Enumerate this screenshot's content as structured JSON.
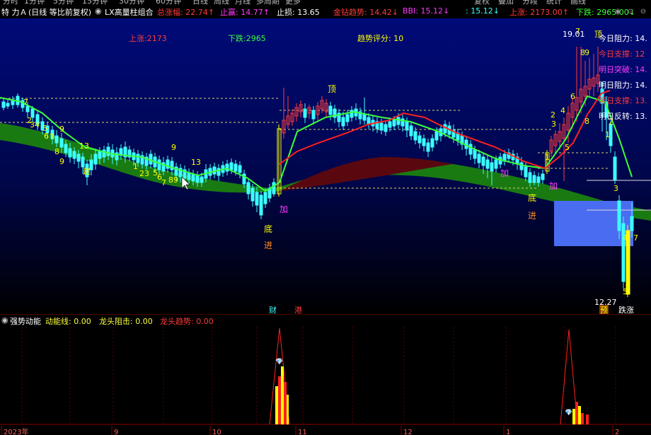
{
  "menu": [
    "分时",
    "1分钟",
    "5分钟",
    "15分钟",
    "30分钟",
    "60分钟",
    "日线",
    "周线",
    "月线",
    "多周期",
    "更多"
  ],
  "toolbar_right": [
    "复权",
    "叠加",
    "分段",
    "统计",
    "画线"
  ],
  "header": {
    "stock_name": "特 力Ａ",
    "period": "(日线 等比前复权)",
    "indicator_name": "LX高量柱组合",
    "items": [
      {
        "label": "总涨幅:",
        "value": "22.74",
        "arrow": "↑",
        "color": "#ff3b3b"
      },
      {
        "label": "止赢:",
        "value": "14.77",
        "arrow": "↑",
        "color": "#ff3bff"
      },
      {
        "label": "止损:",
        "value": "13.65",
        "arrow": "",
        "color": "#ffffff"
      },
      {
        "label": "金钻趋势:",
        "value": "14.42",
        "arrow": "↓",
        "color": "#ff3b3b"
      },
      {
        "label": "BBI:",
        "value": "15.12",
        "arrow": "↓",
        "color": "#ff3bff"
      },
      {
        "label": ":",
        "value": "15.12",
        "arrow": "↓",
        "color": "#3bffff"
      },
      {
        "label": "上涨:",
        "value": "2173.00",
        "arrow": "↑",
        "color": "#ff3b3b"
      },
      {
        "label": "下跌:",
        "value": "2965.00",
        "arrow": "↓",
        "color": "#3bff3b"
      }
    ]
  },
  "overlay": {
    "up_count": "上涨:2173",
    "down_count": "下跌:2965",
    "trend_score": "趋势评分:  10",
    "high_price": "19.01",
    "low_price": "12.27"
  },
  "levels": [
    {
      "label": "今日阻力:",
      "value": "14.",
      "color": "#ffffff"
    },
    {
      "label": "今日支撑:",
      "value": "12",
      "color": "#ff3b3b"
    },
    {
      "label": "明日突破:",
      "value": "14.",
      "color": "#ff3bff"
    },
    {
      "label": "明日阻力:",
      "value": "14.",
      "color": "#ffffff"
    },
    {
      "label": "明日支撑:",
      "value": "13.",
      "color": "#ff3b3b"
    },
    {
      "label": "明日反转:",
      "value": "13.",
      "color": "#ffffff"
    }
  ],
  "markers": {
    "ding": "顶",
    "di": "底",
    "jin": "进",
    "jia": "加",
    "cai": "财",
    "gang": "港",
    "yu": "预",
    "tie": "跌涨"
  },
  "sub": {
    "name": "强势动能",
    "items": [
      {
        "label": "动能线:",
        "value": "0.00",
        "color": "#ffff3b"
      },
      {
        "label": "龙头阻击:",
        "value": "0.00",
        "color": "#ffff3b"
      },
      {
        "label": "龙头趋势:",
        "value": "0.00",
        "color": "#ff3b3b"
      }
    ]
  },
  "x_axis": [
    "2023年",
    "9",
    "10",
    "11",
    "12",
    "1",
    "2"
  ],
  "colors": {
    "up": "#ff3b3b",
    "down": "#3bffff",
    "ma_green": "#3bff3b",
    "ma_red": "#ff2020",
    "yellow": "#ffff00"
  }
}
